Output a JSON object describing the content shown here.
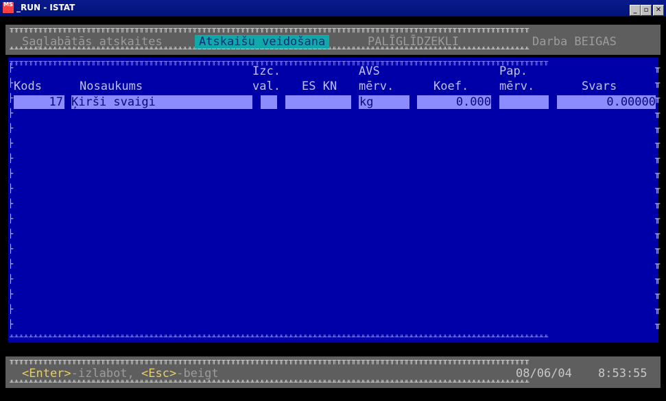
{
  "window": {
    "title": "_RUN - ISTAT",
    "icon_text": "MS",
    "min_glyph": "_",
    "max_glyph": "▫",
    "close_glyph": "✕"
  },
  "menu": {
    "items": [
      {
        "label": "Saglabātās atskaites"
      },
      {
        "label": "Atskaišu veidošana"
      },
      {
        "label": "PALĪGLĪDZEKĻI"
      },
      {
        "label": "Darba BEIGAS"
      }
    ]
  },
  "table": {
    "columns": {
      "kods": "Kods",
      "nosaukums": "Nosaukums",
      "izc_top": "Izc.",
      "izc_bottom": "val.",
      "es_kn": "ES KN",
      "avs_top": "AVS",
      "avs_bottom": "mērv.",
      "koef": "Koef.",
      "pap_top": "Pap.",
      "pap_bottom": "mērv.",
      "svars": "Svars"
    },
    "rows": [
      {
        "kods": "17",
        "nosaukums": "Ķirši svaigi",
        "izc_val": "",
        "es_kn": "",
        "avs_merv": "kg",
        "koef": "0.000",
        "pap_merv": "",
        "svars": "0.00000"
      }
    ]
  },
  "status": {
    "enter_key": "<Enter>",
    "enter_action": "-izlabot, ",
    "esc_key": "<Esc>",
    "esc_action": "-beigt",
    "date": "08/06/04",
    "time": "8:53:55"
  },
  "colors": {
    "background": "#0000a8",
    "active_menu": "#10a8a8",
    "selected_row": "#8c8cff",
    "key_hint": "#e8d060"
  }
}
